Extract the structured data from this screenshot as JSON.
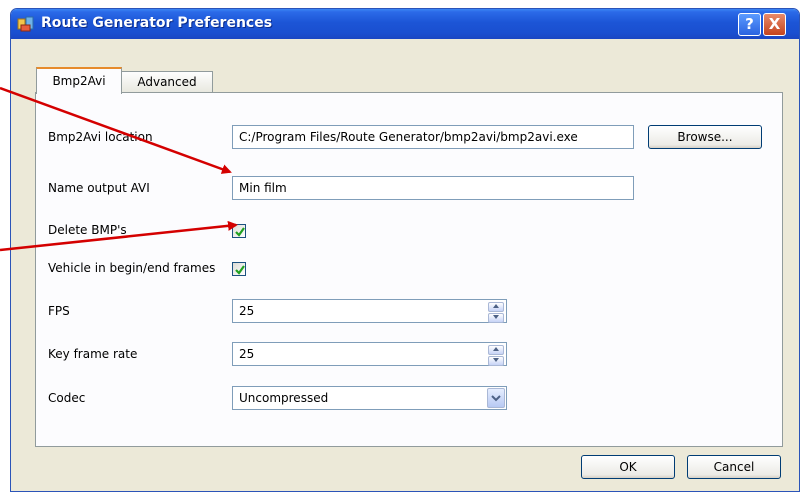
{
  "window": {
    "title": "Route Generator Preferences",
    "help_label": "?",
    "close_label": "X"
  },
  "tabs": [
    {
      "label": "Bmp2Avi",
      "active": true
    },
    {
      "label": "Advanced",
      "active": false
    }
  ],
  "form": {
    "bmp2avi_location": {
      "label": "Bmp2Avi location",
      "value": "C:/Program Files/Route Generator/bmp2avi/bmp2avi.exe"
    },
    "browse_label": "Browse...",
    "name_output_avi": {
      "label": "Name output AVI",
      "value": "Min film"
    },
    "delete_bmps": {
      "label": "Delete BMP's",
      "checked": true
    },
    "vehicle_frames": {
      "label": "Vehicle in begin/end frames",
      "checked": true
    },
    "fps": {
      "label": "FPS",
      "value": "25"
    },
    "key_frame_rate": {
      "label": "Key frame rate",
      "value": "25"
    },
    "codec": {
      "label": "Codec",
      "value": "Uncompressed"
    }
  },
  "footer": {
    "ok_label": "OK",
    "cancel_label": "Cancel"
  },
  "colors": {
    "titlebar": "#1c55d6",
    "annotation_arrow": "#d40000",
    "checkmark": "#21a121"
  }
}
